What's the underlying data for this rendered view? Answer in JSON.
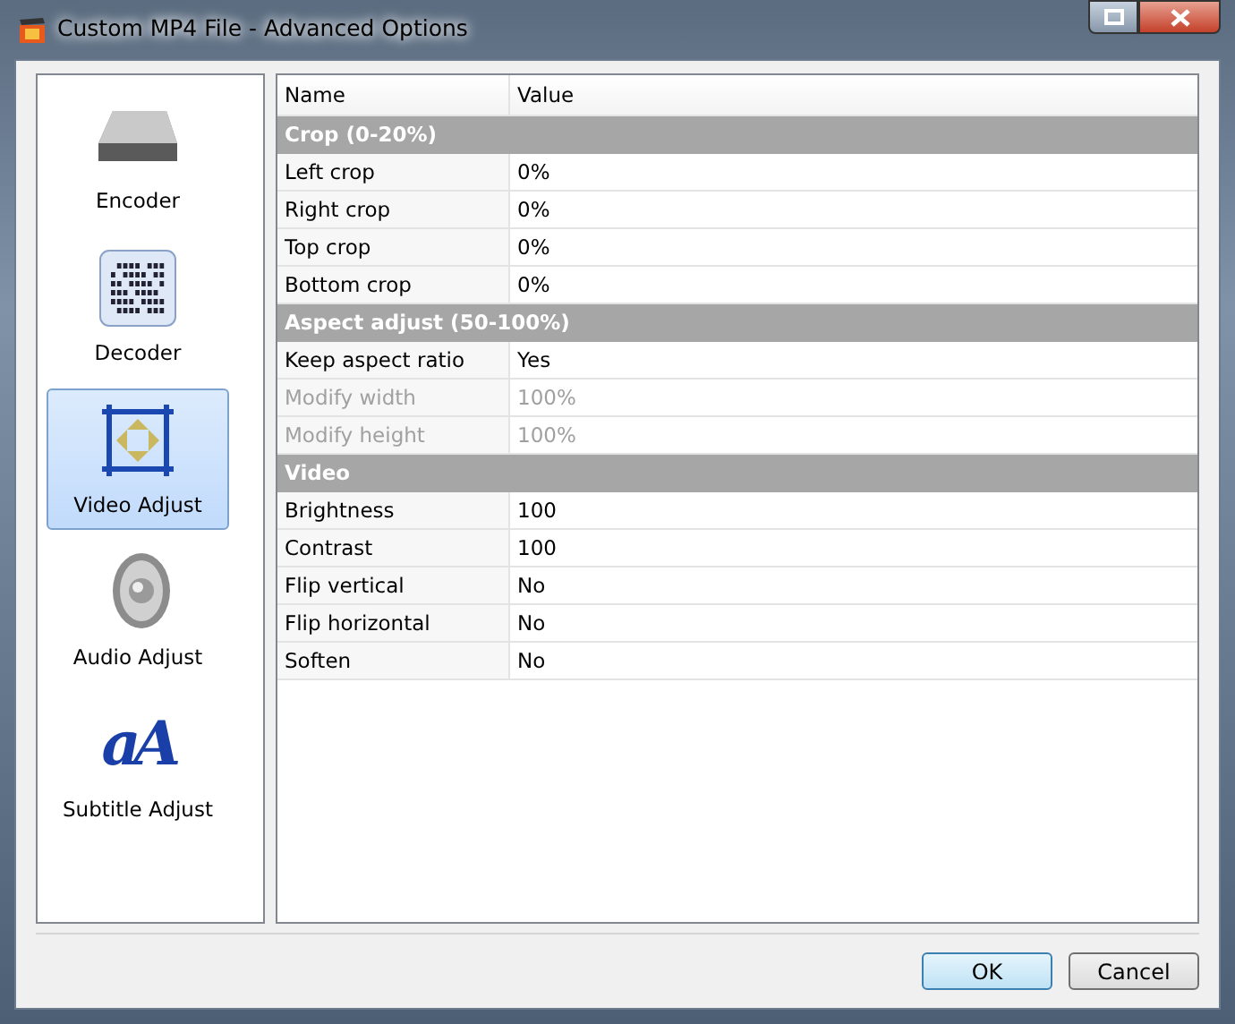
{
  "window": {
    "title": "Custom MP4 File - Advanced Options"
  },
  "sidebar": {
    "items": [
      {
        "label": "Encoder",
        "kind": "drive",
        "selected": false
      },
      {
        "label": "Decoder",
        "kind": "barcode",
        "selected": false
      },
      {
        "label": "Video Adjust",
        "kind": "frame",
        "selected": true
      },
      {
        "label": "Audio Adjust",
        "kind": "speaker",
        "selected": false
      },
      {
        "label": "Subtitle Adjust",
        "kind": "letters",
        "icon_text": "aA",
        "selected": false
      }
    ]
  },
  "grid": {
    "columns": [
      "Name",
      "Value"
    ],
    "sections": [
      {
        "title": "Crop (0-20%)",
        "rows": [
          {
            "name": "Left crop",
            "value": "0%",
            "disabled": false
          },
          {
            "name": "Right crop",
            "value": "0%",
            "disabled": false
          },
          {
            "name": "Top crop",
            "value": "0%",
            "disabled": false
          },
          {
            "name": "Bottom crop",
            "value": "0%",
            "disabled": false
          }
        ]
      },
      {
        "title": "Aspect adjust (50-100%)",
        "rows": [
          {
            "name": "Keep aspect ratio",
            "value": "Yes",
            "disabled": false
          },
          {
            "name": "Modify width",
            "value": "100%",
            "disabled": true
          },
          {
            "name": "Modify height",
            "value": "100%",
            "disabled": true
          }
        ]
      },
      {
        "title": "Video",
        "rows": [
          {
            "name": "Brightness",
            "value": "100",
            "disabled": false
          },
          {
            "name": "Contrast",
            "value": "100",
            "disabled": false
          },
          {
            "name": "Flip vertical",
            "value": "No",
            "disabled": false
          },
          {
            "name": "Flip horizontal",
            "value": "No",
            "disabled": false
          },
          {
            "name": "Soften",
            "value": "No",
            "disabled": false
          }
        ]
      }
    ]
  },
  "buttons": [
    {
      "label": "OK",
      "default": true
    },
    {
      "label": "Cancel",
      "default": false
    }
  ]
}
